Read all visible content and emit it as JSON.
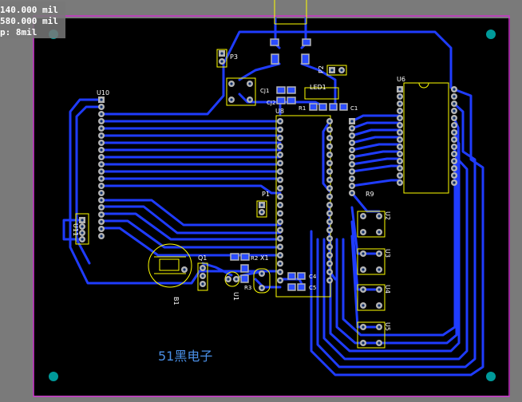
{
  "readout": {
    "x_mil": "140.000 mil",
    "y_mil": "580.000 mil",
    "snap": "p: 8mil"
  },
  "silkscreen_text": "51黑电子",
  "colors": {
    "board_bg": "#000000",
    "outline": "#cc33cc",
    "trace": "#1f3cff",
    "silk": "#ffff00",
    "pad_face": "#b4b4b4",
    "pad_drill": "#0a2a66",
    "via_blue": "#2b4cff",
    "mount_hole": "#009a9a",
    "label_blue": "#4a8fe6",
    "hud_bg": "#7a7a7a"
  },
  "designators": {
    "U10": "U10",
    "U11": "U11",
    "U8": "U8",
    "U6": "U6",
    "U2": "U2",
    "U3": "U3",
    "U4": "U4",
    "U5": "U5",
    "U1": "U1",
    "P1": "P1",
    "P2": "P2",
    "P3": "P3",
    "LED1": "LED1",
    "R9": "R9",
    "Q1": "Q1",
    "X1": "X1",
    "B1": "B1",
    "CJ1": "CJ1",
    "CJ2": "CJ2",
    "R1": "R1",
    "C1": "C1",
    "C4": "C4",
    "C5": "C5",
    "R2": "R2",
    "R3": "R3"
  }
}
